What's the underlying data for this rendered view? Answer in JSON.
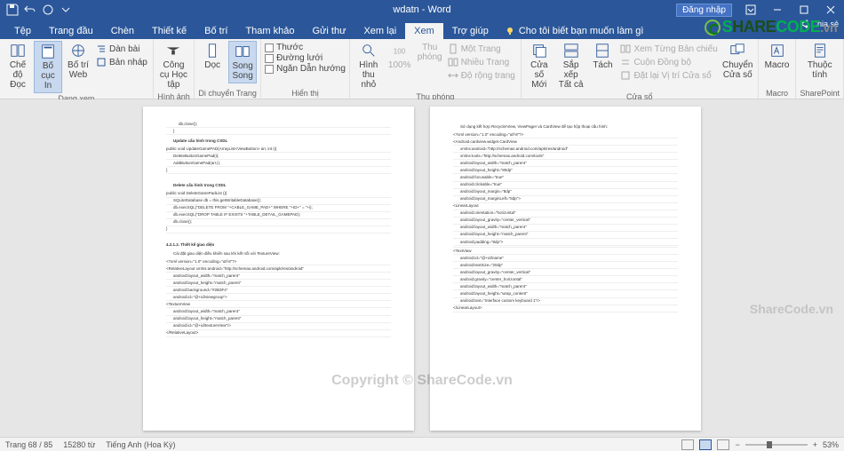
{
  "title": "wdatn  -  Word",
  "signin": "Đăng nhập",
  "tabs": [
    "Tệp",
    "Trang đầu",
    "Chèn",
    "Thiết kế",
    "Bố trí",
    "Tham khảo",
    "Gửi thư",
    "Xem lại",
    "Xem",
    "Trợ giúp"
  ],
  "active_tab": "Xem",
  "tell_me": "Cho tôi biết bạn muốn làm gì",
  "share_top": "Chia sẻ",
  "ribbon": {
    "views": {
      "read": "Chế độ Đọc",
      "printlayout": "Bố cục In",
      "web": "Bố trí Web",
      "outline": "Dàn bài",
      "draft": "Bản nháp",
      "label": "Dạng xem"
    },
    "immersive": {
      "learning": "Công cụ Học tập",
      "label": "Hình ảnh chân thực"
    },
    "pagemove": {
      "vertical": "Dọc",
      "side": "Song Song",
      "label": "Di chuyển Trang"
    },
    "show": {
      "ruler": "Thước",
      "grid": "Đường lưới",
      "nav": "Ngăn Dẫn hướng",
      "label": "Hiển thị"
    },
    "zoom": {
      "zoom": "Hình thu nhỏ",
      "hundred": "100%",
      "thu": "Thu phóng",
      "one": "Một Trang",
      "multi": "Nhiều Trang",
      "width": "Độ rộng trang",
      "label": "Thu phóng"
    },
    "window": {
      "new": "Cửa số Mới",
      "arrange": "Sắp xếp Tất cả",
      "split": "Tách",
      "side": "Xem Từng Bản chiếu",
      "sync": "Cuộn Đồng bộ",
      "reset": "Đặt lại Vị trí Cửa sổ",
      "switch": "Chuyển Cửa số",
      "label": "Cửa sổ"
    },
    "macros": {
      "macros": "Macro",
      "label": "Macro"
    },
    "sharepoint": {
      "prop": "Thuộc tính",
      "label": "SharePoint"
    }
  },
  "status": {
    "page": "Trang 68 / 85",
    "words": "15280 từ",
    "lang": "Tiếng Anh (Hoa Kỳ)",
    "zoom": "53%"
  },
  "watermarks": {
    "big": "Copyright © ShareCode.vn",
    "side": "ShareCode.vn"
  },
  "logo": {
    "s": "S",
    "hare": "HARE",
    "code": "CODE",
    "vn": ".vn"
  },
  "doc": {
    "left": {
      "l0": "db.close();",
      "l1": "}",
      "sec1": "Update cấu hình trong CSDL",
      "l2": "public void UpdateGamePAD(ArrayList<ViewButton> arr, int i){",
      "l3": "DeleteButtonGamePad(i);",
      "l4": "AddButtonGamePad(arr,i);",
      "l5": "}",
      "sec2": "Delete cấu hình trong CSDL",
      "l6": "public void DeleteGamePadList (){",
      "l7": "SQLiteDatabase db = this.getWritableDatabase();",
      "l8": "db.execSQL(\"DELETE FROM \"+CABLE_GAME_PAD+\" WHERE \"+ID+\" = \"+i);",
      "l9": "db.execSQL(\"DROP TABLE IF EXISTS \"+TABLE_DETAIL_GAMEPAD);",
      "l10": "db.close();",
      "l11": "}",
      "sec3": "4.2.1.2. Thiết kế giao diện",
      "sec3b": "Cài đặt giao diện điều khiển sau khi kết nối với TextureView:",
      "l12": "<?xml version=\"1.0\" encoding=\"utf-8\"?>",
      "l13": "<RelativeLayout xmlns:android=\"http://schemas.android.com/apk/res/android\"",
      "l14": "android:layout_width=\"match_parent\"",
      "l15": "android:layout_height=\"match_parent\"",
      "l16": "android:background=\"#2B3F4\"",
      "l17": "android:id=\"@+id/viewgroup\">",
      "l18": "<TextureView",
      "l19": "android:layout_width=\"match_parent\"",
      "l20": "android:layout_height=\"match_parent\"",
      "l21": "android:id=\"@+id/textureView\"/>",
      "l22": "</RelativeLayout>"
    },
    "right": {
      "sec1": "Sử dụng kết hợp RecyclerView, ViewPager và CardView để tạo hộp thoại cấu hình:",
      "l0": "<?xml version=\"1.0\" encoding=\"utf-8\"?>",
      "l1": "<Android.cardview.widget.CardView",
      "l2": "xmlns:android=\"http://schemas.android.com/apk/res/android\"",
      "l3": "xmlns:tools=\"http://schemas.android.com/tools\"",
      "l4": "android:layout_width=\"match_parent\"",
      "l5": "android:layout_height=\"80dp\"",
      "l6": "android:focusable=\"true\"",
      "l7": "android:clickable=\"true\"",
      "l8": "android:layout_margin=\"8dp\"",
      "l9": "android:layout_marginLeft=\"8dp\">",
      "l10": "<LinearLayout",
      "l11": "android:orientation=\"horizontal\"",
      "l12": "android:layout_gravity=\"center_vertical\"",
      "l13": "android:layout_width=\"match_parent\"",
      "l14": "android:layout_height=\"match_parent\"",
      "l15": "android:padding=\"8dp\">",
      "l16": "",
      "l17": "<TextView",
      "l18": "android:id=\"@+id/name\"",
      "l19": "android:textSize=\"20dp\"",
      "l20": "android:layout_gravity=\"center_vertical\"",
      "l21": "android:gravity=\"center_horizontal\"",
      "l22": "android:layout_width=\"match_parent\"",
      "l23": "android:layout_height=\"wrap_content\"",
      "l24": "android:text=\"Interface custom keyboard 1\"/>",
      "l25": "</LinearLayout>"
    }
  }
}
